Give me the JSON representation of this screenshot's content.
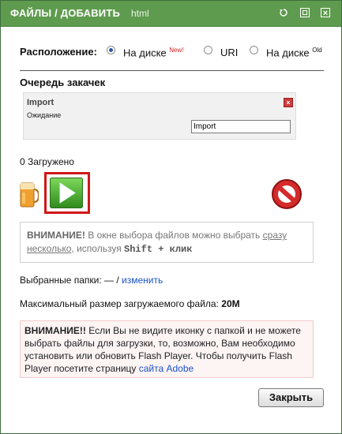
{
  "window": {
    "title": "ФАЙЛЫ / ДОБАВИТЬ",
    "subtitle": "html"
  },
  "location": {
    "label": "Расположение:",
    "options": [
      {
        "label": "На диске",
        "badge": "New!",
        "selected": true
      },
      {
        "label": "URI",
        "badge": "",
        "selected": false
      },
      {
        "label": "На диске",
        "badge": "Old",
        "selected": false
      }
    ]
  },
  "queue": {
    "title": "Очередь закачек",
    "item": {
      "name": "Import",
      "status": "Ожидание",
      "input_value": "Import"
    }
  },
  "uploaded": "0 Загружено",
  "warning1": {
    "strong": "ВНИМАНИЕ!",
    "text1": " В окне выбора файлов можно выбрать ",
    "link": "сразу несколько",
    "text2": ", используя ",
    "keys": "Shift + клик"
  },
  "folders": {
    "label": "Выбранные папки: — /",
    "link": "изменить"
  },
  "max_size": {
    "label": "Максимальный размер загружаемого файла:",
    "value": "20M"
  },
  "warning2": {
    "strong": "ВНИМАНИЕ!!",
    "text": " Если Вы не видите иконку с папкой и не можете выбрать файлы для загрузки, то, возможно, Вам необходимо установить или обновить Flash Player. Чтобы получить Flash Player посетите страницу ",
    "link": "сайта Adobe"
  },
  "close_label": "Закрыть",
  "icons": {
    "refresh": "refresh-icon",
    "restore": "restore-icon",
    "close": "close-icon",
    "jar": "jar-icon",
    "play": "play-icon",
    "stop": "stop-icon"
  },
  "colors": {
    "titlebar": "#5f9b4f",
    "link": "#1a52c9",
    "highlight_border": "#d01818",
    "alert_bg": "#fdf4f4"
  }
}
